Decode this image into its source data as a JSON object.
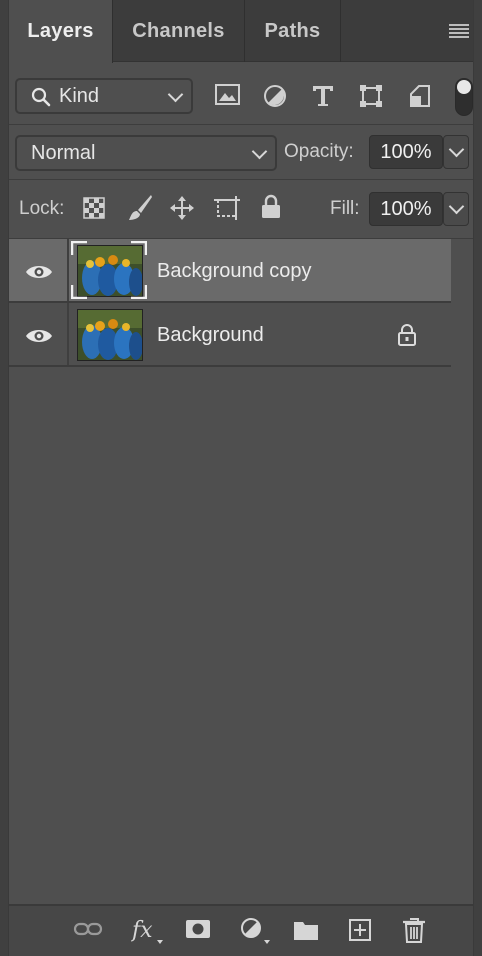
{
  "tabs": [
    {
      "label": "Layers",
      "active": true
    },
    {
      "label": "Channels",
      "active": false
    },
    {
      "label": "Paths",
      "active": false
    }
  ],
  "filter": {
    "kind_label": "Kind",
    "icons": [
      "image-filter-icon",
      "adjustment-filter-icon",
      "type-filter-icon",
      "shape-filter-icon",
      "smart-object-filter-icon"
    ],
    "toggle_on": true
  },
  "blend": {
    "mode": "Normal",
    "opacity_label": "Opacity:",
    "opacity_value": "100%"
  },
  "lock": {
    "label": "Lock:",
    "icons": [
      "lock-transparent-pixels-icon",
      "lock-image-pixels-icon",
      "lock-position-icon",
      "lock-artboard-icon",
      "lock-all-icon"
    ],
    "fill_label": "Fill:",
    "fill_value": "100%"
  },
  "layers": [
    {
      "name": "Background copy",
      "selected": true,
      "visible": true,
      "locked": false
    },
    {
      "name": "Background",
      "selected": false,
      "visible": true,
      "locked": true
    }
  ],
  "bottom_icons": [
    "link-layers-icon",
    "fx-layer-style-icon",
    "add-mask-icon",
    "adjustment-layer-icon",
    "new-group-icon",
    "new-layer-icon",
    "delete-layer-icon"
  ],
  "colors": {
    "panel_bg": "#4f4f4f",
    "selected_row": "#6a6a6a",
    "tab_bar": "#3c3c3c"
  }
}
